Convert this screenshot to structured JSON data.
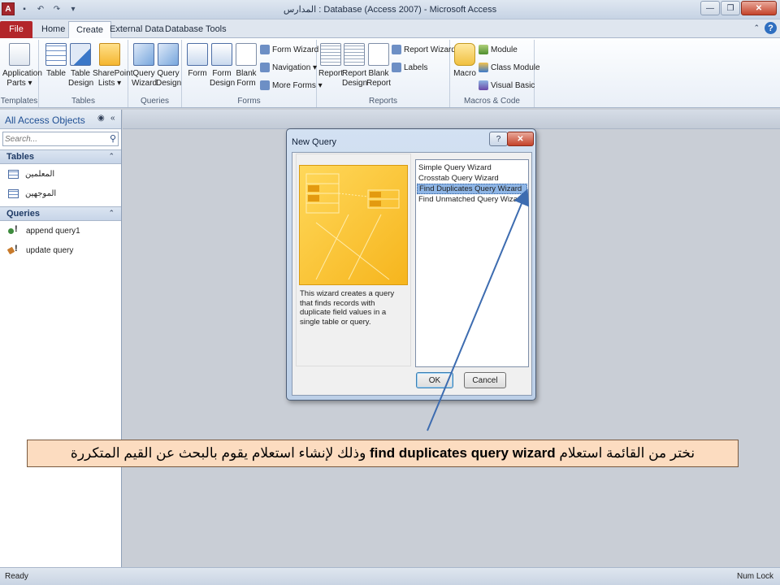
{
  "window": {
    "title": "المدارس : Database (Access 2007) - Microsoft Access",
    "controls": {
      "minimize": "—",
      "restore": "❐",
      "close": "✕"
    }
  },
  "quick_access": {
    "logo": "A",
    "save": "▪",
    "undo": "↶",
    "redo": "↷",
    "customize": "▾"
  },
  "tabs": [
    {
      "label": "File"
    },
    {
      "label": "Home"
    },
    {
      "label": "Create"
    },
    {
      "label": "External Data"
    },
    {
      "label": "Database Tools"
    }
  ],
  "ribbon": {
    "groups": {
      "templates": "Templates",
      "tables": "Tables",
      "queries": "Queries",
      "forms": "Forms",
      "reports": "Reports",
      "macros": "Macros & Code"
    },
    "buttons": {
      "app_parts_1": "Application",
      "app_parts_2": "Parts ▾",
      "table": "Table",
      "table_design_1": "Table",
      "table_design_2": "Design",
      "sharepoint_1": "SharePoint",
      "sharepoint_2": "Lists ▾",
      "query_wizard_1": "Query",
      "query_wizard_2": "Wizard",
      "query_design_1": "Query",
      "query_design_2": "Design",
      "form": "Form",
      "form_design_1": "Form",
      "form_design_2": "Design",
      "blank_form_1": "Blank",
      "blank_form_2": "Form",
      "form_wizard": "Form Wizard",
      "navigation": "Navigation ▾",
      "more_forms": "More Forms ▾",
      "report": "Report",
      "report_design_1": "Report",
      "report_design_2": "Design",
      "blank_report_1": "Blank",
      "blank_report_2": "Report",
      "report_wizard": "Report Wizard",
      "labels": "Labels",
      "macro": "Macro",
      "module": "Module",
      "class_module": "Class Module",
      "visual_basic": "Visual Basic"
    }
  },
  "nav_pane": {
    "header": "All Access Objects",
    "search_placeholder": "Search...",
    "groups": [
      {
        "label": "Tables",
        "items": [
          "المعلمين",
          "الموجهين"
        ]
      },
      {
        "label": "Queries",
        "items": [
          "append query1",
          "update query"
        ]
      }
    ]
  },
  "dialog": {
    "title": "New Query",
    "description": "This wizard creates a query that finds records with duplicate field values in a single table or query.",
    "wizards": [
      "Simple Query Wizard",
      "Crosstab Query Wizard",
      "Find Duplicates Query Wizard",
      "Find Unmatched Query Wizard"
    ],
    "selected_index": 2,
    "ok_label": "OK",
    "cancel_label": "Cancel"
  },
  "callout": {
    "before": "نختر من القائمة استعلام ",
    "bold": "find duplicates query wizard",
    "after": " وذلك لإنشاء استعلام يقوم بالبحث عن القيم المتكررة"
  },
  "status_bar": {
    "left": "Ready",
    "right": "Num Lock"
  },
  "colors": {
    "file_tab": "#b3262a",
    "selection": "#8fb6e6",
    "callout_bg": "#fcdcc0",
    "arrow": "#3d6cb0"
  }
}
